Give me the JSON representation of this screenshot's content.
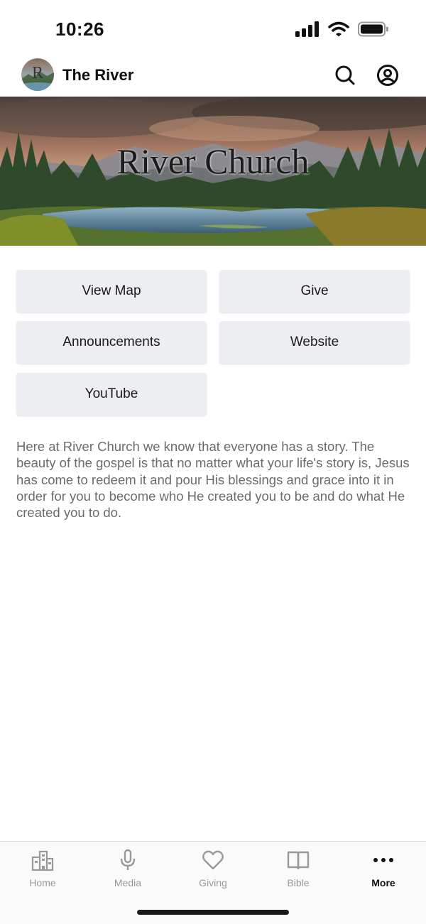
{
  "status_bar": {
    "time": "10:26",
    "icons": [
      "signal-icon",
      "wifi-icon",
      "battery-icon"
    ]
  },
  "header": {
    "title": "The River",
    "logo_letter": "R",
    "icons": [
      "search-icon",
      "account-icon"
    ]
  },
  "banner": {
    "title": "River Church"
  },
  "buttons": {
    "view_map": "View Map",
    "give": "Give",
    "announcements": "Announcements",
    "website": "Website",
    "youtube": "YouTube"
  },
  "description": "Here at River Church we know that everyone has a story. The beauty of the gospel is that no matter what your life's story is, Jesus has come to redeem it and pour His blessings and grace into it in order for you to become who He created you to be and do what He created you to do.",
  "tabs": [
    {
      "label": "Home",
      "icon": "building-icon",
      "active": false
    },
    {
      "label": "Media",
      "icon": "microphone-icon",
      "active": false
    },
    {
      "label": "Giving",
      "icon": "heart-icon",
      "active": false
    },
    {
      "label": "Bible",
      "icon": "book-icon",
      "active": false
    },
    {
      "label": "More",
      "icon": "more-icon",
      "active": true
    }
  ],
  "colors": {
    "accent": "#111111",
    "inactive_tab": "#999999",
    "button_bg": "#eceef1",
    "body_text": "#6b6b6b"
  }
}
